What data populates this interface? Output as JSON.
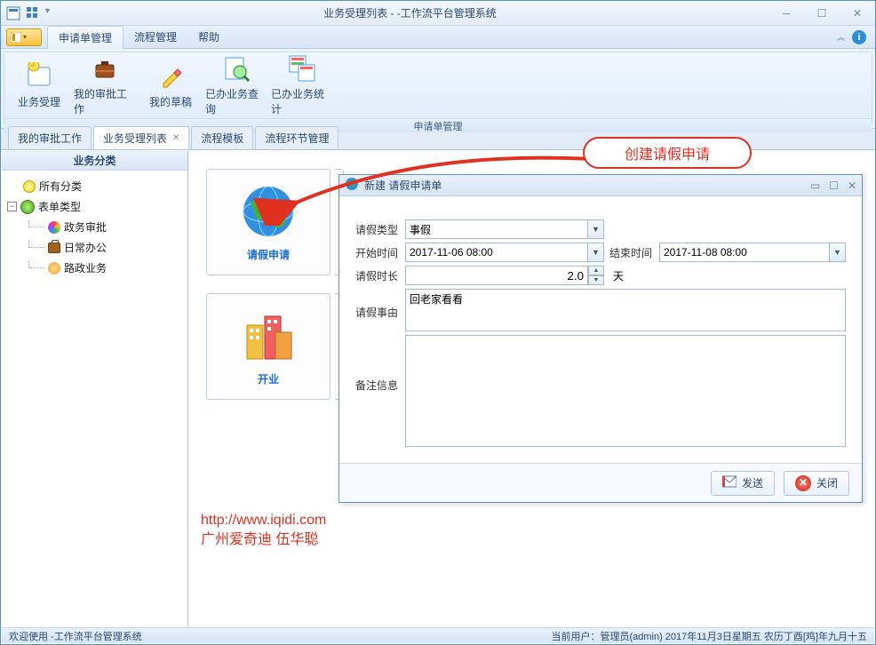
{
  "window": {
    "title": "业务受理列表 - -工作流平台管理系统"
  },
  "menu": {
    "tabs": [
      "申请单管理",
      "流程管理",
      "帮助"
    ],
    "active": 0
  },
  "ribbon": {
    "items": [
      {
        "label": "业务受理"
      },
      {
        "label": "我的审批工作"
      },
      {
        "label": "我的草稿"
      },
      {
        "label": "已办业务查询"
      },
      {
        "label": "已办业务统计"
      }
    ],
    "group_title": "申请单管理"
  },
  "doc_tabs": {
    "items": [
      "我的审批工作",
      "业务受理列表",
      "流程模板",
      "流程环节管理"
    ],
    "active": 1
  },
  "sidebar": {
    "title": "业务分类",
    "root": "所有分类",
    "group": "表单类型",
    "children": [
      "政务审批",
      "日常办公",
      "路政业务"
    ]
  },
  "tiles": {
    "leave": "请假申请",
    "open": "开业"
  },
  "callout": {
    "text": "创建请假申请"
  },
  "dialog": {
    "title": "新建 请假申请单",
    "fields": {
      "type_label": "请假类型",
      "type_value": "事假",
      "start_label": "开始时间",
      "start_value": "2017-11-06 08:00",
      "end_label": "结束时间",
      "end_value": "2017-11-08 08:00",
      "duration_label": "请假时长",
      "duration_value": "2.0",
      "duration_unit": "天",
      "reason_label": "请假事由",
      "reason_value": "回老家看看",
      "remark_label": "备注信息",
      "remark_value": ""
    },
    "buttons": {
      "send": "发送",
      "close": "关闭"
    }
  },
  "watermark": {
    "line1": "http://www.iqidi.com",
    "line2": "广州爱奇迪  伍华聪"
  },
  "status": {
    "left": "欢迎使用 -工作流平台管理系统",
    "right": "当前用户：管理员(admin)   2017年11月3日星期五 农历丁酉[鸡]年九月十五"
  }
}
